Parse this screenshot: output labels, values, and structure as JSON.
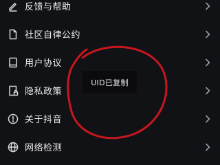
{
  "menu": {
    "items": [
      {
        "label": "反馈与帮助",
        "icon": "edit-pencil-icon"
      },
      {
        "label": "社区自律公约",
        "icon": "document-icon"
      },
      {
        "label": "用户协议",
        "icon": "book-icon"
      },
      {
        "label": "隐私政策",
        "icon": "lock-document-icon"
      },
      {
        "label": "关于抖音",
        "icon": "info-circle-icon"
      },
      {
        "label": "网络检测",
        "icon": "globe-icon"
      }
    ]
  },
  "toast": {
    "message": "UID已复制"
  },
  "colors": {
    "background": "#111216",
    "text": "#ececee",
    "annotation": "#c8161d",
    "toast_background": "#0b0b0d"
  }
}
